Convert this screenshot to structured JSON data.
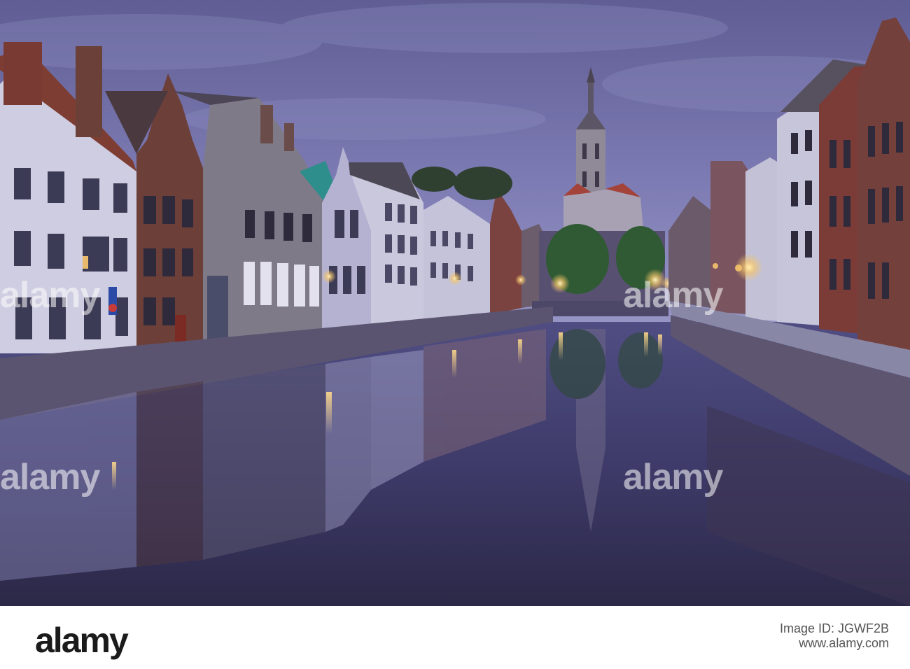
{
  "photo": {
    "colors": {
      "sky_top": "#6b6a9e",
      "sky_bottom": "#8c8bbd",
      "water_top": "#514f86",
      "water_bottom": "#2a2746",
      "warm_light": "#f6c66a",
      "brick": "#6e3e3a",
      "white_facade": "#c9c9dd"
    }
  },
  "watermark": {
    "text": "alamy"
  },
  "footer": {
    "logo": "alamy",
    "stock_line": "Image ID: JGWF2B",
    "site": "www.alamy.com"
  }
}
